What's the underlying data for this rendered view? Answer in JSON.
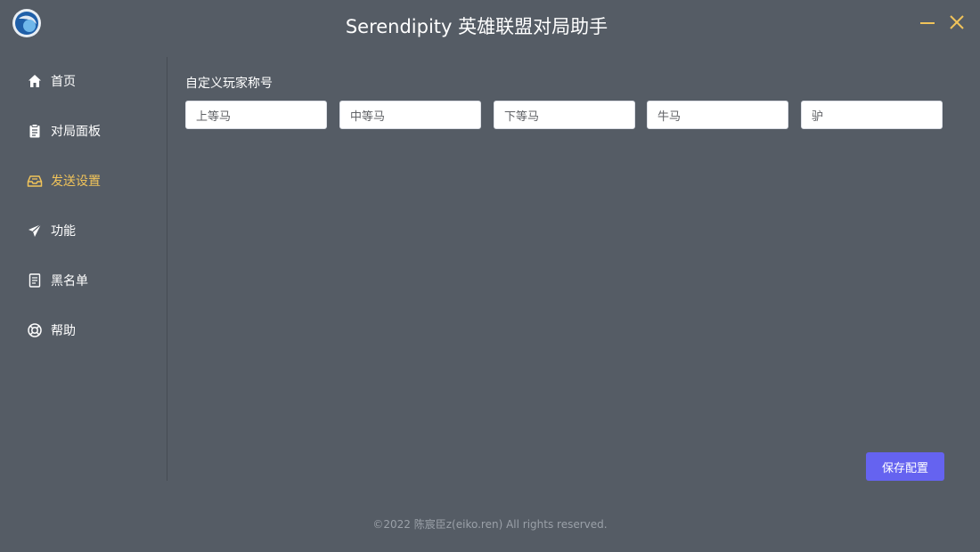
{
  "app": {
    "title": "Serendipity 英雄联盟对局助手"
  },
  "window_controls": {
    "minimize_icon": "minimize-icon",
    "close_icon": "close-icon",
    "accent_color": "#f0c35a"
  },
  "sidebar": {
    "active_index": 2,
    "active_color": "#f0c35a",
    "items": [
      {
        "label": "首页",
        "icon": "home-icon"
      },
      {
        "label": "对局面板",
        "icon": "clipboard-icon"
      },
      {
        "label": "发送设置",
        "icon": "inbox-icon"
      },
      {
        "label": "功能",
        "icon": "send-icon"
      },
      {
        "label": "黑名单",
        "icon": "document-icon"
      },
      {
        "label": "帮助",
        "icon": "lifebuoy-icon"
      }
    ]
  },
  "main": {
    "section_label": "自定义玩家称号",
    "inputs": [
      {
        "value": "上等马"
      },
      {
        "value": "中等马"
      },
      {
        "value": "下等马"
      },
      {
        "value": "牛马"
      },
      {
        "value": "驴"
      }
    ],
    "save_label": "保存配置",
    "save_color": "#6563f0"
  },
  "footer": {
    "copyright": "©2022 陈宸臣z(eiko.ren) All rights reserved."
  }
}
